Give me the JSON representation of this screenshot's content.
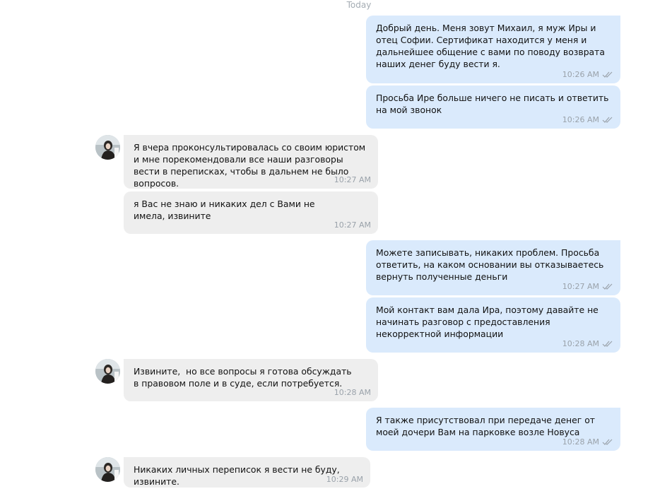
{
  "date_divider": "Today",
  "colors": {
    "outgoing_bubble": "#daeafc",
    "incoming_bubble": "#eeeeee",
    "timestamp": "#9aa2aa"
  },
  "messages": [
    {
      "direction": "out",
      "text": "Добрый день. Меня зовут Михаил, я муж Иры и отец Софии. Сертификат находится у меня и дальнейшее общение с вами по поводу возврата наших денег буду вести я.",
      "time": "10:26 AM",
      "status_icon": "double-check-icon"
    },
    {
      "direction": "out",
      "text": "Просьба Ире больше ничего не писать и ответить на мой звонок",
      "time": "10:26 AM",
      "status_icon": "double-check-icon"
    },
    {
      "direction": "in",
      "text": "Я вчера проконсультировалась со своим юристом и мне порекомендовали все наши разговоры вести в переписках, чтобы в дальнем не было вопросов.",
      "time": "10:27 AM"
    },
    {
      "direction": "in",
      "text": "я Вас не знаю и никаких дел с Вами не имела, извините",
      "time": "10:27 AM"
    },
    {
      "direction": "out",
      "text": "Можете записывать, никаких проблем. Просьба ответить, на каком основании вы отказываетесь вернуть полученные деньги",
      "time": "10:27 AM",
      "status_icon": "double-check-icon"
    },
    {
      "direction": "out",
      "text": "Мой контакт вам дала Ира, поэтому давайте не начинать разговор с предоставления некорректной информации",
      "time": "10:28 AM",
      "status_icon": "double-check-icon"
    },
    {
      "direction": "in",
      "text": "Извините,  но все вопросы я готова обсуждать в правовом поле и в суде, если потребуется.",
      "time": "10:28 AM"
    },
    {
      "direction": "out",
      "text": "Я также присутствовал при передаче денег от моей дочери Вам на парковке возле Новуса",
      "time": "10:28 AM",
      "status_icon": "double-check-icon"
    },
    {
      "direction": "in",
      "text": "Никаких личных переписок я вести не буду, извините.",
      "time": "10:29 AM"
    }
  ]
}
